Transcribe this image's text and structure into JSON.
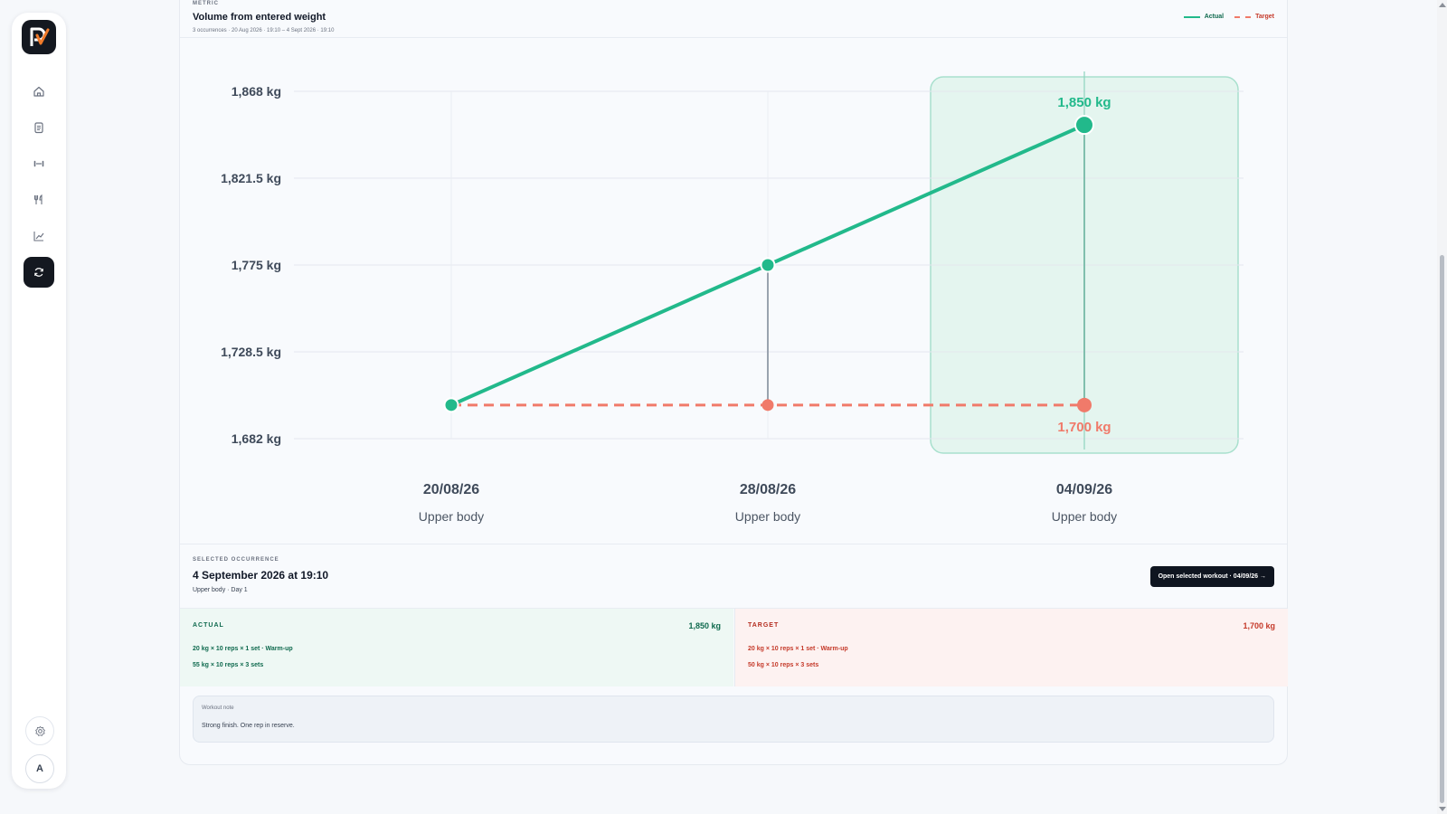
{
  "app": {
    "logo_text": "PV",
    "nav": [
      {
        "name": "home-icon",
        "active": false
      },
      {
        "name": "clipboard-icon",
        "active": false
      },
      {
        "name": "dumbbell-icon",
        "active": false
      },
      {
        "name": "utensils-icon",
        "active": false
      },
      {
        "name": "chart-icon",
        "active": false
      },
      {
        "name": "refresh-icon",
        "active": true
      }
    ],
    "settings_icon": "gear-icon",
    "avatar_initial": "A"
  },
  "metric": {
    "eyebrow": "METRIC",
    "title": "Volume from entered weight",
    "subtitle": "3 occurrences · 20 Aug 2026 · 19:10 – 4 Sept 2026 · 19:10",
    "legend": [
      {
        "label": "Actual",
        "color": "#22b98b",
        "style": "solid"
      },
      {
        "label": "Target",
        "color": "#f07a6a",
        "style": "dashed"
      }
    ]
  },
  "chart_data": {
    "type": "line",
    "x": [
      "20/08/26",
      "28/08/26",
      "04/09/26"
    ],
    "x_sublabels": [
      "Upper body",
      "Upper body",
      "Upper body"
    ],
    "yticks": [
      "1,868 kg",
      "1,821.5 kg",
      "1,775 kg",
      "1,728.5 kg",
      "1,682 kg"
    ],
    "ylim": [
      1682,
      1868
    ],
    "unit": "kg",
    "series": [
      {
        "name": "Actual",
        "values": [
          1700,
          1775,
          1850
        ],
        "color": "#22b98b",
        "style": "solid"
      },
      {
        "name": "Target",
        "values": [
          1700,
          1700,
          1700
        ],
        "color": "#f07a6a",
        "style": "dashed"
      }
    ],
    "selected_index": 2,
    "selected_labels": {
      "actual": "1,850 kg",
      "target": "1,700 kg"
    },
    "grid": true
  },
  "selected": {
    "eyebrow": "SELECTED OCCURRENCE",
    "title": "4 September 2026 at 19:10",
    "subtitle": "Upper body · Day 1",
    "open_button": "Open selected workout · 04/09/26 →",
    "actual": {
      "label": "ACTUAL",
      "total": "1,850 kg",
      "lines": [
        "20 kg × 10 reps × 1 set · Warm-up",
        "55 kg × 10 reps × 3 sets"
      ]
    },
    "target": {
      "label": "TARGET",
      "total": "1,700 kg",
      "lines": [
        "20 kg × 10 reps × 1 set · Warm-up",
        "50 kg × 10 reps × 3 sets"
      ]
    },
    "note": {
      "label": "Workout note",
      "text": "Strong finish. One rep in reserve."
    }
  }
}
